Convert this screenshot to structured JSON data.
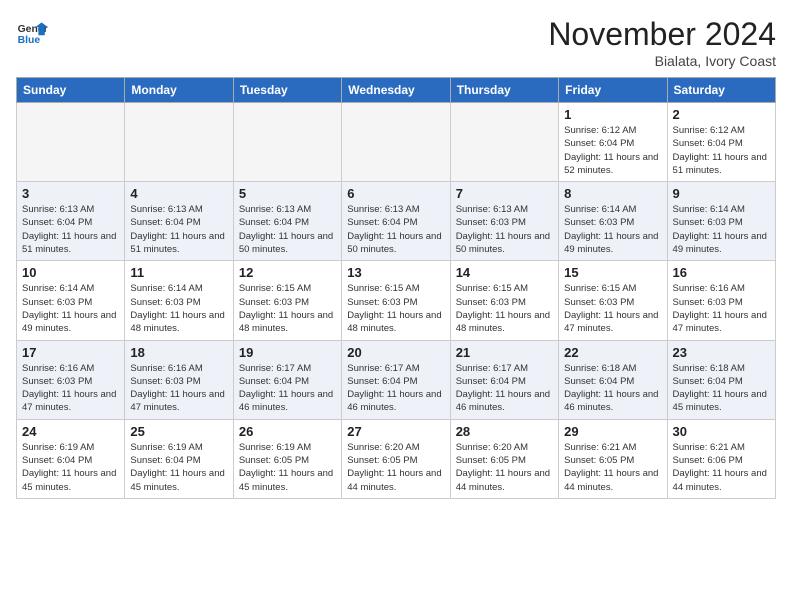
{
  "header": {
    "logo_line1": "General",
    "logo_line2": "Blue",
    "month_title": "November 2024",
    "location": "Bialata, Ivory Coast"
  },
  "weekdays": [
    "Sunday",
    "Monday",
    "Tuesday",
    "Wednesday",
    "Thursday",
    "Friday",
    "Saturday"
  ],
  "weeks": [
    [
      {
        "day": "",
        "empty": true
      },
      {
        "day": "",
        "empty": true
      },
      {
        "day": "",
        "empty": true
      },
      {
        "day": "",
        "empty": true
      },
      {
        "day": "",
        "empty": true
      },
      {
        "day": "1",
        "sunrise": "Sunrise: 6:12 AM",
        "sunset": "Sunset: 6:04 PM",
        "daylight": "Daylight: 11 hours and 52 minutes."
      },
      {
        "day": "2",
        "sunrise": "Sunrise: 6:12 AM",
        "sunset": "Sunset: 6:04 PM",
        "daylight": "Daylight: 11 hours and 51 minutes."
      }
    ],
    [
      {
        "day": "3",
        "sunrise": "Sunrise: 6:13 AM",
        "sunset": "Sunset: 6:04 PM",
        "daylight": "Daylight: 11 hours and 51 minutes."
      },
      {
        "day": "4",
        "sunrise": "Sunrise: 6:13 AM",
        "sunset": "Sunset: 6:04 PM",
        "daylight": "Daylight: 11 hours and 51 minutes."
      },
      {
        "day": "5",
        "sunrise": "Sunrise: 6:13 AM",
        "sunset": "Sunset: 6:04 PM",
        "daylight": "Daylight: 11 hours and 50 minutes."
      },
      {
        "day": "6",
        "sunrise": "Sunrise: 6:13 AM",
        "sunset": "Sunset: 6:04 PM",
        "daylight": "Daylight: 11 hours and 50 minutes."
      },
      {
        "day": "7",
        "sunrise": "Sunrise: 6:13 AM",
        "sunset": "Sunset: 6:03 PM",
        "daylight": "Daylight: 11 hours and 50 minutes."
      },
      {
        "day": "8",
        "sunrise": "Sunrise: 6:14 AM",
        "sunset": "Sunset: 6:03 PM",
        "daylight": "Daylight: 11 hours and 49 minutes."
      },
      {
        "day": "9",
        "sunrise": "Sunrise: 6:14 AM",
        "sunset": "Sunset: 6:03 PM",
        "daylight": "Daylight: 11 hours and 49 minutes."
      }
    ],
    [
      {
        "day": "10",
        "sunrise": "Sunrise: 6:14 AM",
        "sunset": "Sunset: 6:03 PM",
        "daylight": "Daylight: 11 hours and 49 minutes."
      },
      {
        "day": "11",
        "sunrise": "Sunrise: 6:14 AM",
        "sunset": "Sunset: 6:03 PM",
        "daylight": "Daylight: 11 hours and 48 minutes."
      },
      {
        "day": "12",
        "sunrise": "Sunrise: 6:15 AM",
        "sunset": "Sunset: 6:03 PM",
        "daylight": "Daylight: 11 hours and 48 minutes."
      },
      {
        "day": "13",
        "sunrise": "Sunrise: 6:15 AM",
        "sunset": "Sunset: 6:03 PM",
        "daylight": "Daylight: 11 hours and 48 minutes."
      },
      {
        "day": "14",
        "sunrise": "Sunrise: 6:15 AM",
        "sunset": "Sunset: 6:03 PM",
        "daylight": "Daylight: 11 hours and 48 minutes."
      },
      {
        "day": "15",
        "sunrise": "Sunrise: 6:15 AM",
        "sunset": "Sunset: 6:03 PM",
        "daylight": "Daylight: 11 hours and 47 minutes."
      },
      {
        "day": "16",
        "sunrise": "Sunrise: 6:16 AM",
        "sunset": "Sunset: 6:03 PM",
        "daylight": "Daylight: 11 hours and 47 minutes."
      }
    ],
    [
      {
        "day": "17",
        "sunrise": "Sunrise: 6:16 AM",
        "sunset": "Sunset: 6:03 PM",
        "daylight": "Daylight: 11 hours and 47 minutes."
      },
      {
        "day": "18",
        "sunrise": "Sunrise: 6:16 AM",
        "sunset": "Sunset: 6:03 PM",
        "daylight": "Daylight: 11 hours and 47 minutes."
      },
      {
        "day": "19",
        "sunrise": "Sunrise: 6:17 AM",
        "sunset": "Sunset: 6:04 PM",
        "daylight": "Daylight: 11 hours and 46 minutes."
      },
      {
        "day": "20",
        "sunrise": "Sunrise: 6:17 AM",
        "sunset": "Sunset: 6:04 PM",
        "daylight": "Daylight: 11 hours and 46 minutes."
      },
      {
        "day": "21",
        "sunrise": "Sunrise: 6:17 AM",
        "sunset": "Sunset: 6:04 PM",
        "daylight": "Daylight: 11 hours and 46 minutes."
      },
      {
        "day": "22",
        "sunrise": "Sunrise: 6:18 AM",
        "sunset": "Sunset: 6:04 PM",
        "daylight": "Daylight: 11 hours and 46 minutes."
      },
      {
        "day": "23",
        "sunrise": "Sunrise: 6:18 AM",
        "sunset": "Sunset: 6:04 PM",
        "daylight": "Daylight: 11 hours and 45 minutes."
      }
    ],
    [
      {
        "day": "24",
        "sunrise": "Sunrise: 6:19 AM",
        "sunset": "Sunset: 6:04 PM",
        "daylight": "Daylight: 11 hours and 45 minutes."
      },
      {
        "day": "25",
        "sunrise": "Sunrise: 6:19 AM",
        "sunset": "Sunset: 6:04 PM",
        "daylight": "Daylight: 11 hours and 45 minutes."
      },
      {
        "day": "26",
        "sunrise": "Sunrise: 6:19 AM",
        "sunset": "Sunset: 6:05 PM",
        "daylight": "Daylight: 11 hours and 45 minutes."
      },
      {
        "day": "27",
        "sunrise": "Sunrise: 6:20 AM",
        "sunset": "Sunset: 6:05 PM",
        "daylight": "Daylight: 11 hours and 44 minutes."
      },
      {
        "day": "28",
        "sunrise": "Sunrise: 6:20 AM",
        "sunset": "Sunset: 6:05 PM",
        "daylight": "Daylight: 11 hours and 44 minutes."
      },
      {
        "day": "29",
        "sunrise": "Sunrise: 6:21 AM",
        "sunset": "Sunset: 6:05 PM",
        "daylight": "Daylight: 11 hours and 44 minutes."
      },
      {
        "day": "30",
        "sunrise": "Sunrise: 6:21 AM",
        "sunset": "Sunset: 6:06 PM",
        "daylight": "Daylight: 11 hours and 44 minutes."
      }
    ]
  ]
}
